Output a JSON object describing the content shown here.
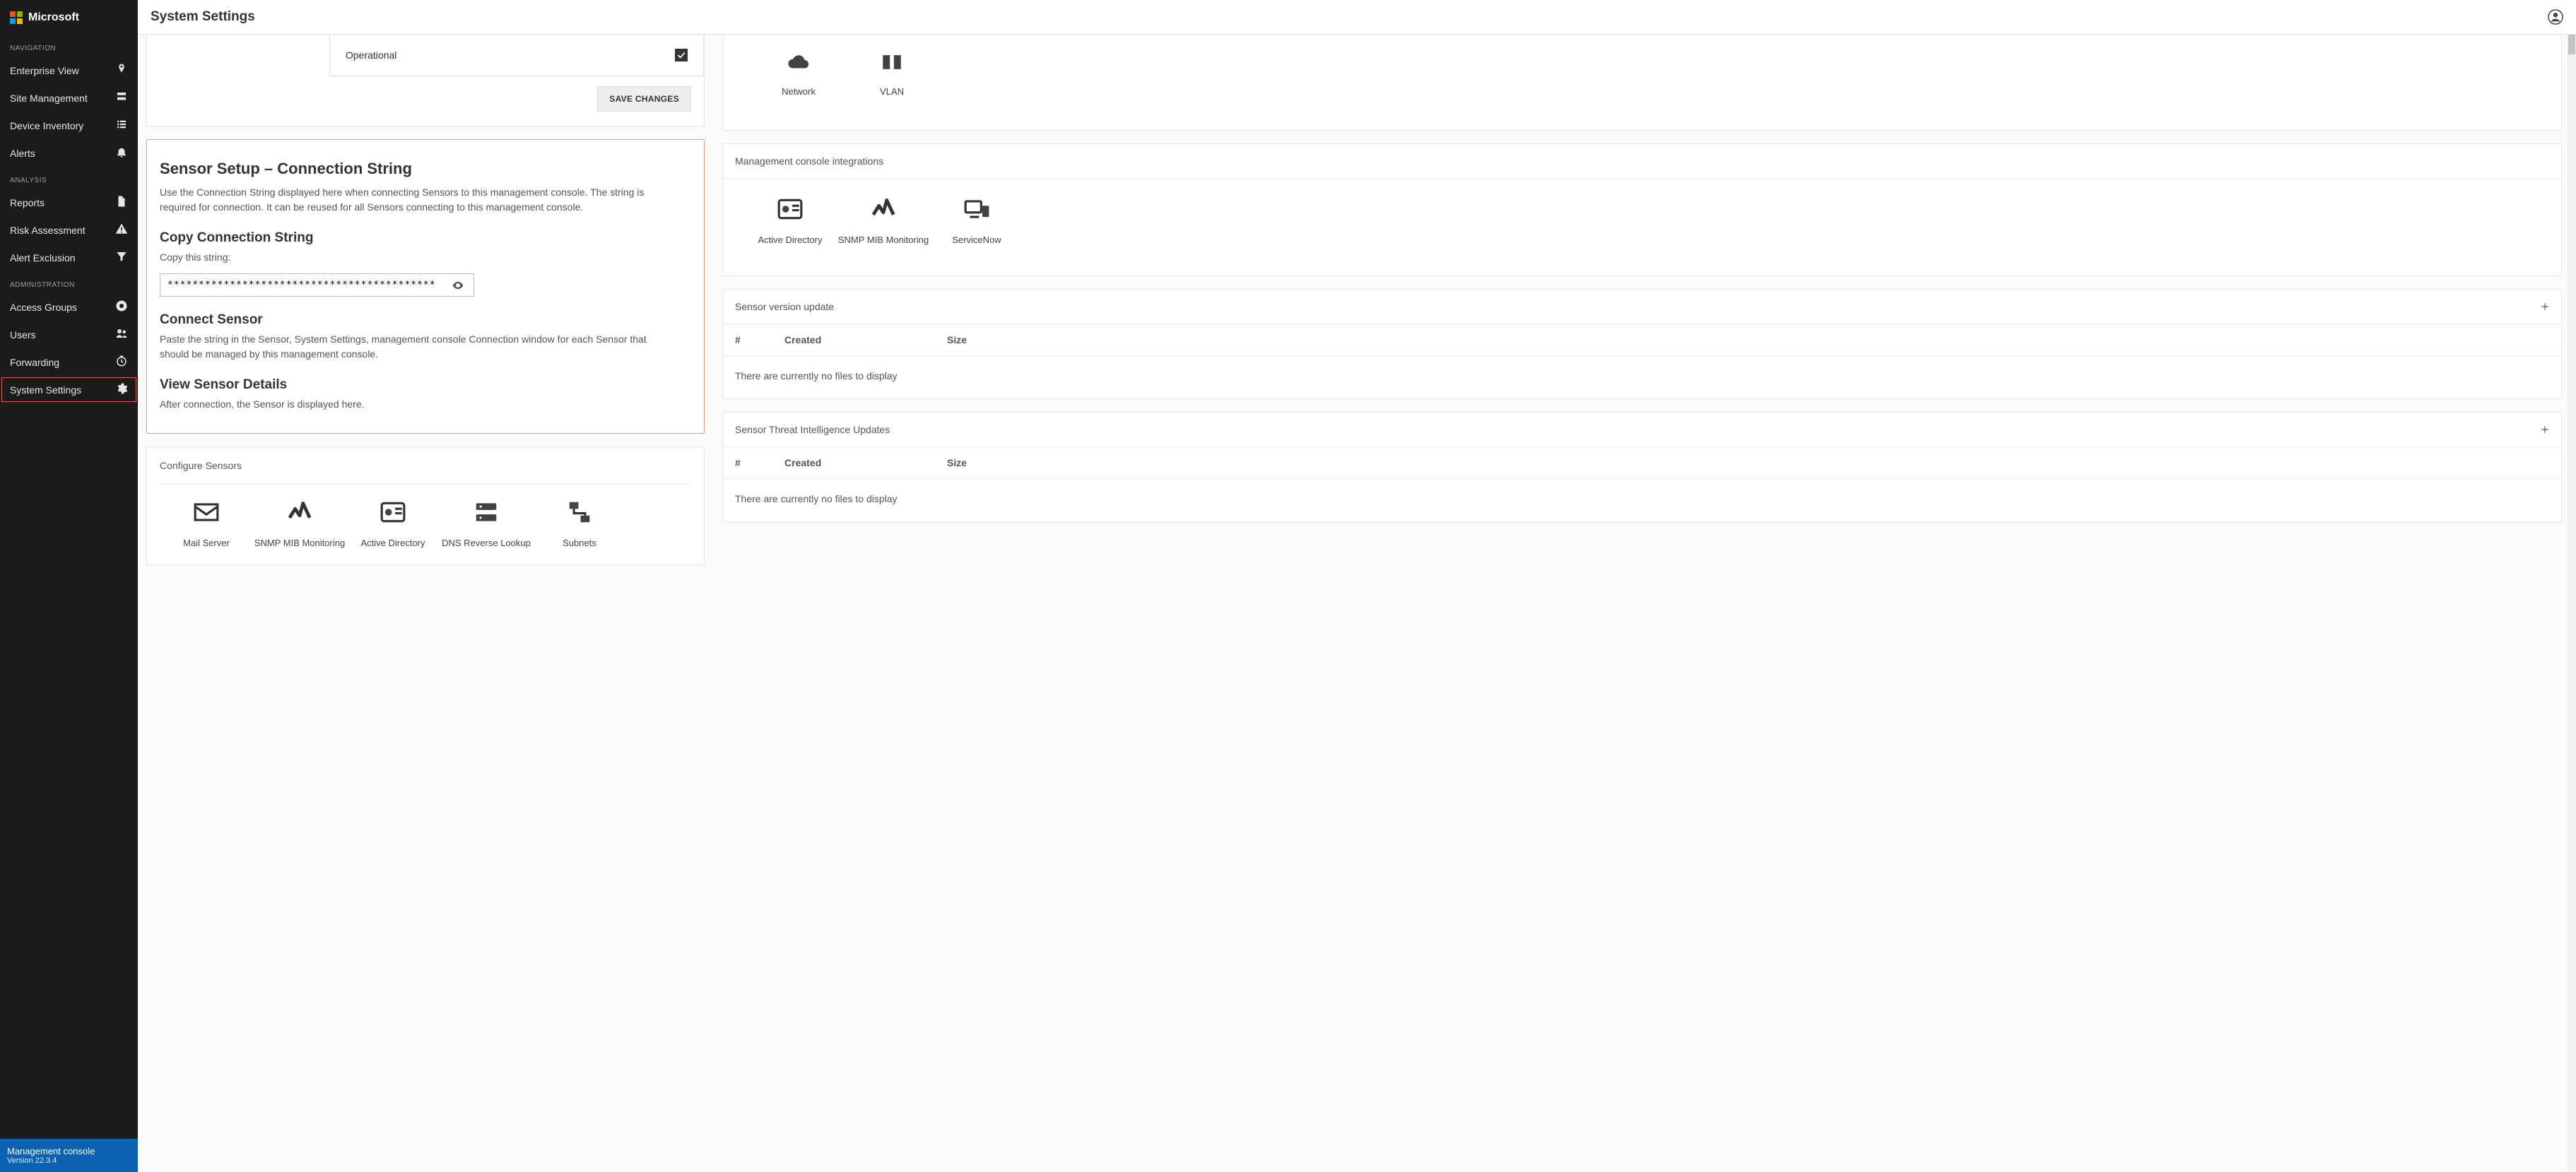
{
  "brand": "Microsoft",
  "topbar": {
    "title": "System Settings"
  },
  "sidebar": {
    "sections": [
      {
        "label": "NAVIGATION",
        "items": [
          {
            "label": "Enterprise View",
            "icon": "pin"
          },
          {
            "label": "Site Management",
            "icon": "server"
          },
          {
            "label": "Device Inventory",
            "icon": "list"
          },
          {
            "label": "Alerts",
            "icon": "bell"
          }
        ]
      },
      {
        "label": "ANALYSIS",
        "items": [
          {
            "label": "Reports",
            "icon": "file"
          },
          {
            "label": "Risk Assessment",
            "icon": "warning"
          },
          {
            "label": "Alert Exclusion",
            "icon": "filter"
          }
        ]
      },
      {
        "label": "ADMINISTRATION",
        "items": [
          {
            "label": "Access Groups",
            "icon": "groups"
          },
          {
            "label": "Users",
            "icon": "people"
          },
          {
            "label": "Forwarding",
            "icon": "clock"
          },
          {
            "label": "System Settings",
            "icon": "gear",
            "active": true
          }
        ]
      }
    ],
    "footer": {
      "title": "Management console",
      "version": "Version 22.3.4"
    }
  },
  "operational": {
    "label": "Operational",
    "checked": true,
    "save": "SAVE CHANGES"
  },
  "sensor_setup": {
    "title": "Sensor Setup – Connection String",
    "desc": "Use the Connection String displayed here when connecting Sensors to this management console. The string is required for connection. It can be reused for all Sensors connecting to this management console.",
    "copy_title": "Copy Connection String",
    "copy_label": "Copy this string:",
    "masked": "**********************************************",
    "connect_title": "Connect Sensor",
    "connect_desc": "Paste the string in the Sensor, System Settings, management console Connection window for each Sensor that should be managed by this management console.",
    "view_title": "View Sensor Details",
    "view_desc": "After connection, the Sensor is displayed here."
  },
  "configure": {
    "title": "Configure Sensors",
    "tiles": [
      {
        "label": "Mail Server",
        "icon": "mail"
      },
      {
        "label": "SNMP MIB Monitoring",
        "icon": "activity"
      },
      {
        "label": "Active Directory",
        "icon": "badge"
      },
      {
        "label": "DNS Reverse Lookup",
        "icon": "dns"
      },
      {
        "label": "Subnets",
        "icon": "subnets"
      }
    ]
  },
  "right_top": {
    "tiles": [
      {
        "label": "Network",
        "icon": "cloud"
      },
      {
        "label": "VLAN",
        "icon": "vlan"
      }
    ]
  },
  "integrations": {
    "title": "Management console integrations",
    "tiles": [
      {
        "label": "Active Directory",
        "icon": "badge"
      },
      {
        "label": "SNMP MIB Monitoring",
        "icon": "activity"
      },
      {
        "label": "ServiceNow",
        "icon": "devices"
      }
    ]
  },
  "version_update": {
    "title": "Sensor version update",
    "cols": {
      "num": "#",
      "created": "Created",
      "size": "Size"
    },
    "empty": "There are currently no files to display"
  },
  "threat_update": {
    "title": "Sensor Threat Intelligence Updates",
    "cols": {
      "num": "#",
      "created": "Created",
      "size": "Size"
    },
    "empty": "There are currently no files to display"
  }
}
